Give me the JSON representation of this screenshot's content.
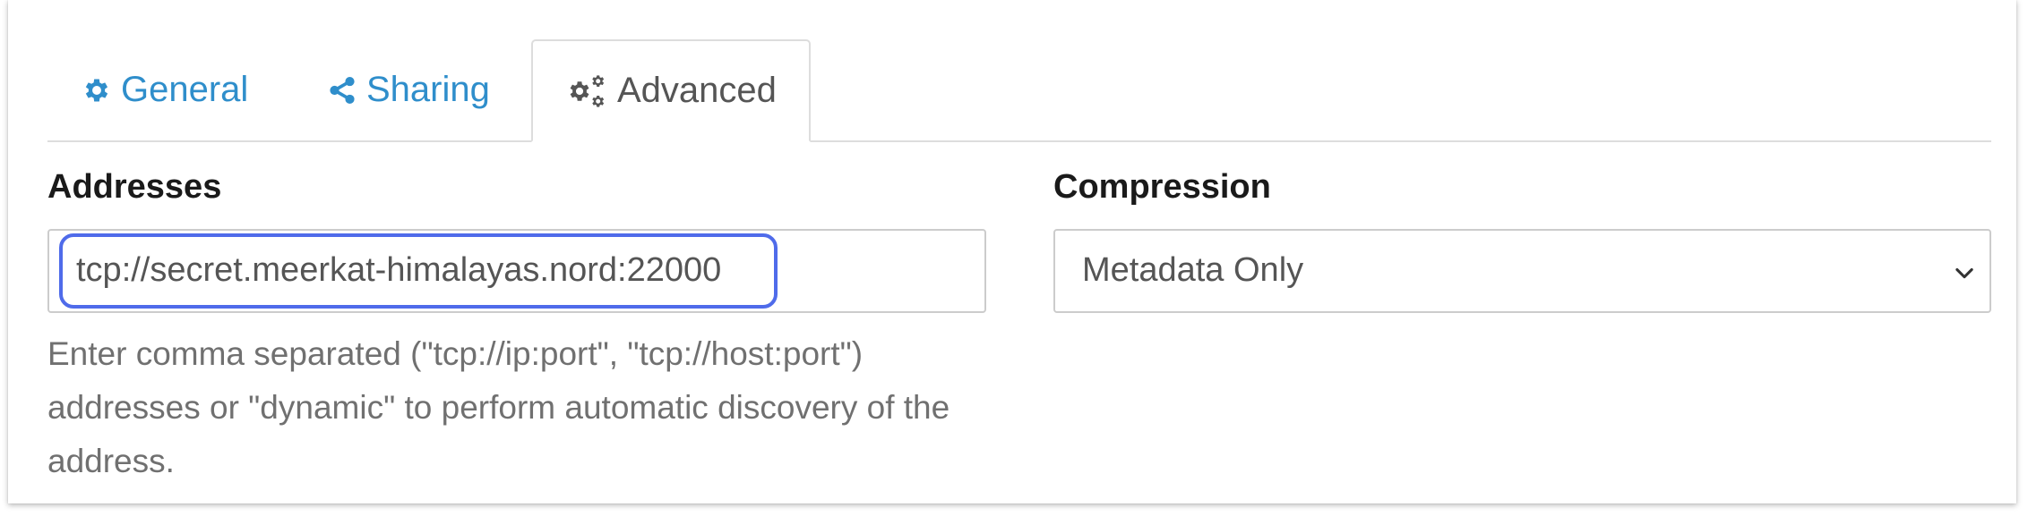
{
  "tabs": [
    {
      "label": "General",
      "icon": "gear-icon",
      "active": false
    },
    {
      "label": "Sharing",
      "icon": "share-icon",
      "active": false
    },
    {
      "label": "Advanced",
      "icon": "gears-icon",
      "active": true
    }
  ],
  "addresses": {
    "label": "Addresses",
    "value": "tcp://secret.meerkat-himalayas.nord:22000",
    "help": "Enter comma separated (\"tcp://ip:port\", \"tcp://host:port\") addresses or \"dynamic\" to perform automatic discovery of the address."
  },
  "compression": {
    "label": "Compression",
    "selected": "Metadata Only"
  },
  "colors": {
    "link": "#2f8ecb",
    "active_tab_text": "#555555",
    "focus_ring": "#4f6bea"
  }
}
